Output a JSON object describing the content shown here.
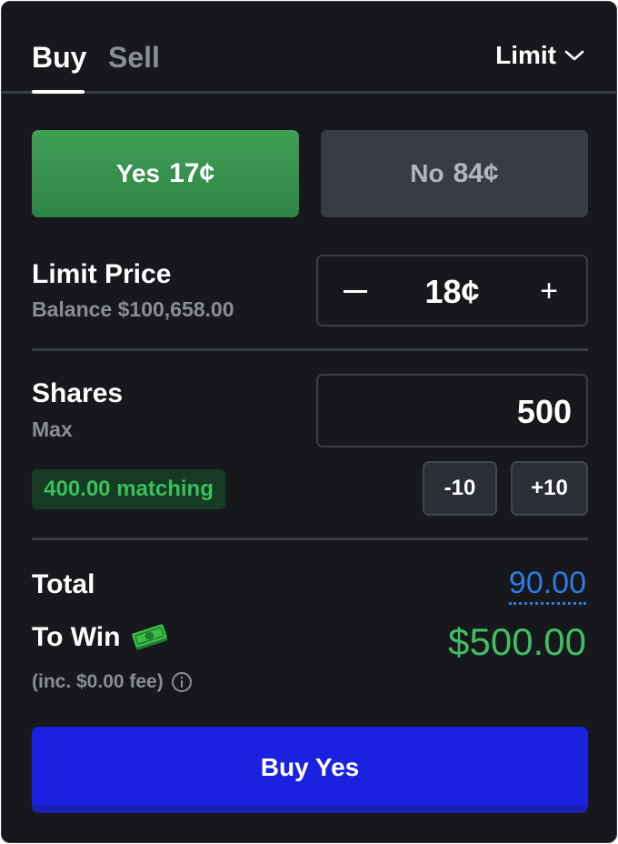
{
  "tabs": {
    "buy_label": "Buy",
    "sell_label": "Sell",
    "active": "Buy"
  },
  "order_type": {
    "label": "Limit",
    "icon": "chevron-down-icon"
  },
  "outcomes": {
    "yes": {
      "label": "Yes",
      "price": "17¢"
    },
    "no": {
      "label": "No",
      "price": "84¢"
    },
    "selected": "yes"
  },
  "limit_price": {
    "label": "Limit Price",
    "balance": "Balance $100,658.00",
    "value": "18¢",
    "minus_icon": "minus-icon",
    "plus_icon": "plus-icon",
    "plus_glyph": "+"
  },
  "shares": {
    "label": "Shares",
    "max_label": "Max",
    "value": "500",
    "matching": "400.00 matching",
    "decrement_label": "-10",
    "increment_label": "+10"
  },
  "summary": {
    "total_label": "Total",
    "total_value": "90.00",
    "to_win_label": "To Win",
    "to_win_icon": "money-icon",
    "to_win_value": "$500.00",
    "fee_note": "(inc. $0.00 fee)",
    "fee_icon": "info-icon"
  },
  "submit": {
    "label": "Buy Yes"
  },
  "colors": {
    "panel_bg": "#17181c",
    "yes_green": "#3f9f55",
    "no_gray": "#393b47",
    "total_blue": "#2f7ae5",
    "win_green": "#3fbf63",
    "submit_blue": "#1a22e0"
  }
}
